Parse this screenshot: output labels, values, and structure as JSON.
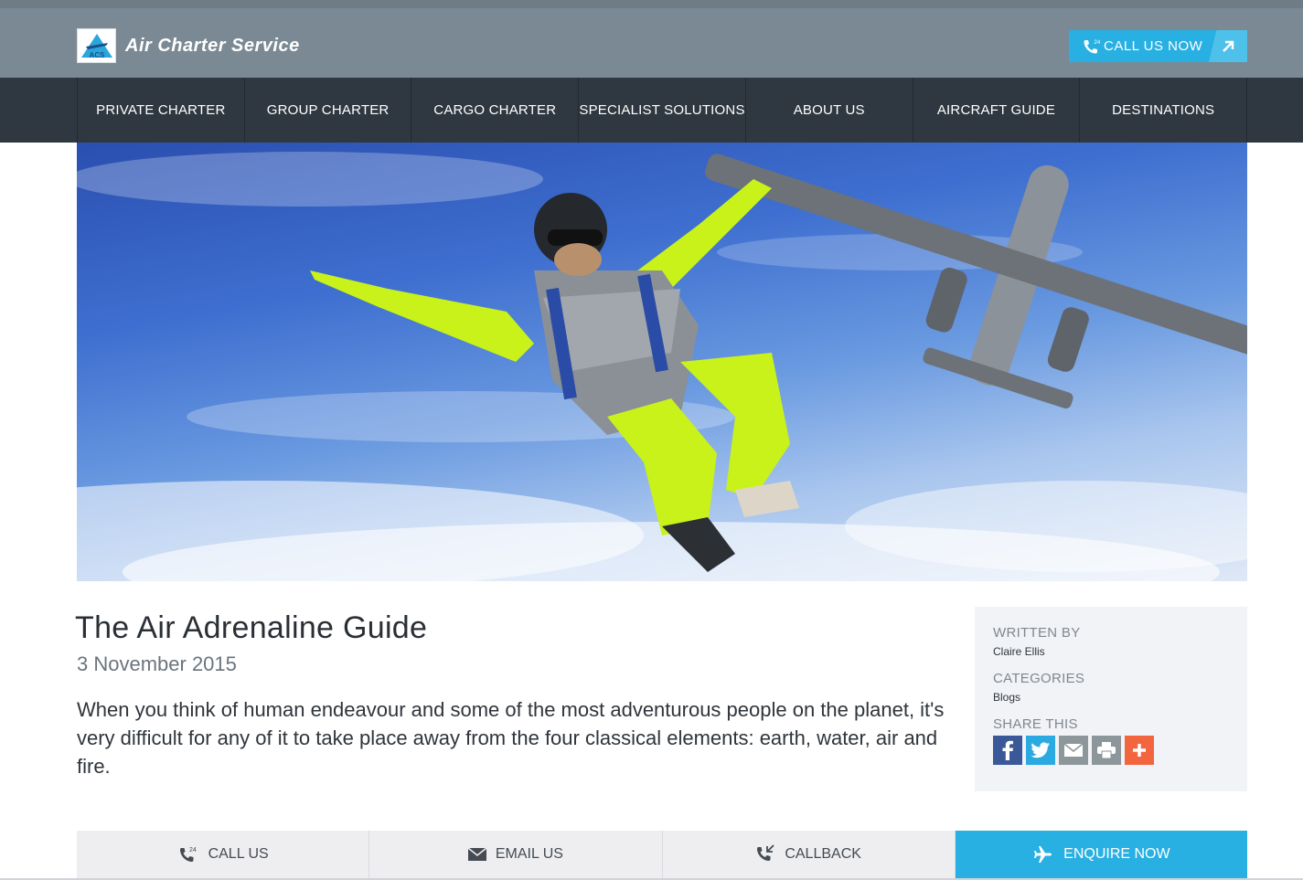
{
  "header": {
    "logo_abbrev": "ACS",
    "logo_text": "Air Charter Service",
    "call_now_label": "CALL US NOW",
    "call_badge": "24"
  },
  "nav": {
    "items": [
      {
        "label": "PRIVATE CHARTER"
      },
      {
        "label": "GROUP CHARTER"
      },
      {
        "label": "CARGO CHARTER"
      },
      {
        "label": "SPECIALIST SOLUTIONS"
      },
      {
        "label": "ABOUT US"
      },
      {
        "label": "AIRCRAFT GUIDE"
      },
      {
        "label": "DESTINATIONS"
      }
    ]
  },
  "article": {
    "title": "The Air Adrenaline Guide",
    "date": "3 November 2015",
    "intro": "When you think of human endeavour and some of the most adventurous people on the planet, it's very difficult for any of it to take place away from the four classical elements: earth, water, air and fire."
  },
  "sidebar": {
    "written_by_label": "WRITTEN BY",
    "author": "Claire Ellis",
    "categories_label": "CATEGORIES",
    "category": "Blogs",
    "share_label": "SHARE THIS",
    "share_icons": [
      "facebook-icon",
      "twitter-icon",
      "email-icon",
      "print-icon",
      "plus-icon"
    ]
  },
  "bottom_bar": {
    "call_label": "CALL US",
    "email_label": "EMAIL US",
    "callback_label": "CALLBACK",
    "enquire_label": "ENQUIRE NOW",
    "call_badge": "24"
  },
  "colors": {
    "header_bg": "#7a8994",
    "nav_bg": "#2f3840",
    "accent": "#28b0e3",
    "facebook": "#3b5998",
    "twitter": "#2ba9e1",
    "email": "#8d969b",
    "print": "#8d969b",
    "plus": "#f2653e"
  }
}
